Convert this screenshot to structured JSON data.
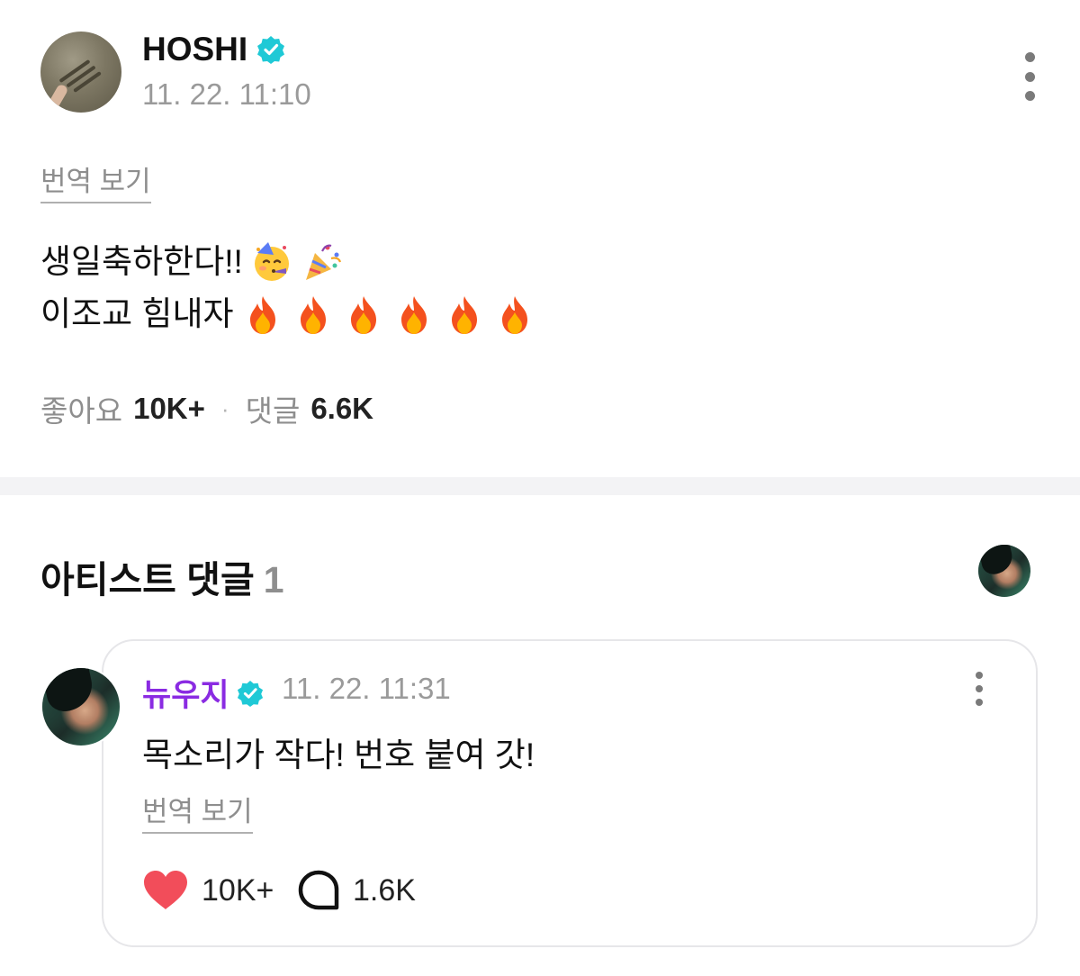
{
  "post": {
    "author": "HOSHI",
    "verified": true,
    "time": "11. 22. 11:10",
    "translate_label": "번역 보기",
    "body_line1": "생일축하한다!!",
    "body_line1_emojis": [
      "partying-face-emoji",
      "party-popper-emoji"
    ],
    "body_line2": "이조교 힘내자",
    "body_line2_emojis": [
      "fire-emoji",
      "fire-emoji",
      "fire-emoji",
      "fire-emoji",
      "fire-emoji",
      "fire-emoji"
    ],
    "likes_label": "좋아요",
    "likes_value": "10K+",
    "separator": "·",
    "comments_label": "댓글",
    "comments_value": "6.6K"
  },
  "artist_comments": {
    "title": "아티스트 댓글",
    "count": "1",
    "comment": {
      "author": "뉴우지",
      "verified": true,
      "time": "11. 22. 11:31",
      "text": "목소리가 작다! 번호 붙여 갓!",
      "translate_label": "번역 보기",
      "likes": "10K+",
      "replies": "1.6K"
    }
  },
  "colors": {
    "verified_badge": "#1fc9d6",
    "commenter_name": "#8a2be2",
    "heart": "#f24d5a",
    "muted_text": "#8e8e8e",
    "divider": "#f3f3f5"
  }
}
